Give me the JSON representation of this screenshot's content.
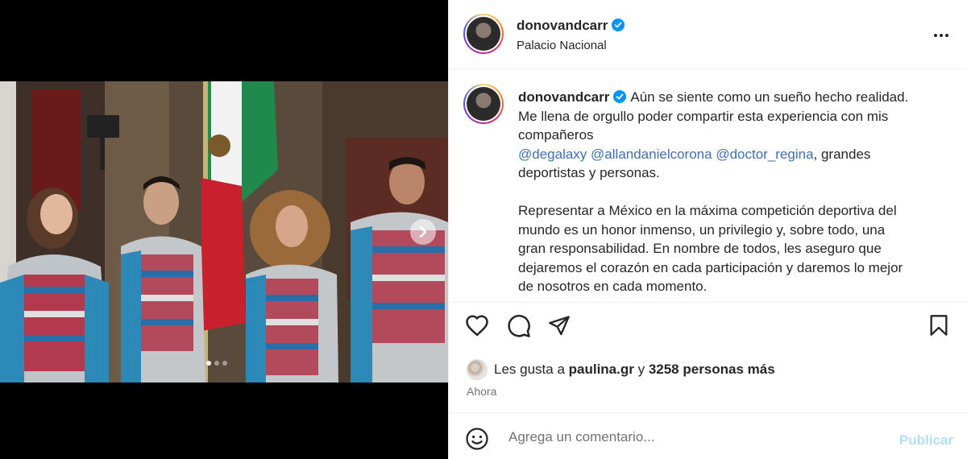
{
  "post": {
    "username": "donovandcarr",
    "location": "Palacio Nacional",
    "verified": true
  },
  "caption": {
    "username": "donovandcarr",
    "line1": "Aún se siente como un sueño hecho realidad.",
    "line2": "Me llena de orgullo poder compartir esta experiencia con mis",
    "line3": "compañeros",
    "mentions": [
      "@degalaxy",
      "@allandanielcorona",
      "@doctor_regina"
    ],
    "line4_tail": ", grandes",
    "line5": "deportistas y personas.",
    "para2": [
      "Representar a México en la máxima competición deportiva del",
      "mundo es un honor inmenso, un privilegio y, sobre todo, una",
      "gran responsabilidad. En nombre de todos, les aseguro que",
      "dejaremos el corazón en cada participación y daremos lo mejor",
      "de nosotros en cada momento."
    ]
  },
  "likes": {
    "prefix": "Les gusta a ",
    "user": "paulina.gr",
    "connector": " y ",
    "others": "3258 personas más"
  },
  "timestamp": "Ahora",
  "comment": {
    "placeholder": "Agrega un comentario...",
    "post_label": "Publicar"
  },
  "carousel": {
    "total": 3,
    "active_index": 0
  },
  "colors": {
    "verified_blue": "#0095f6",
    "mention_blue": "#3f6fb6",
    "post_button_disabled": "#b2dffc"
  }
}
